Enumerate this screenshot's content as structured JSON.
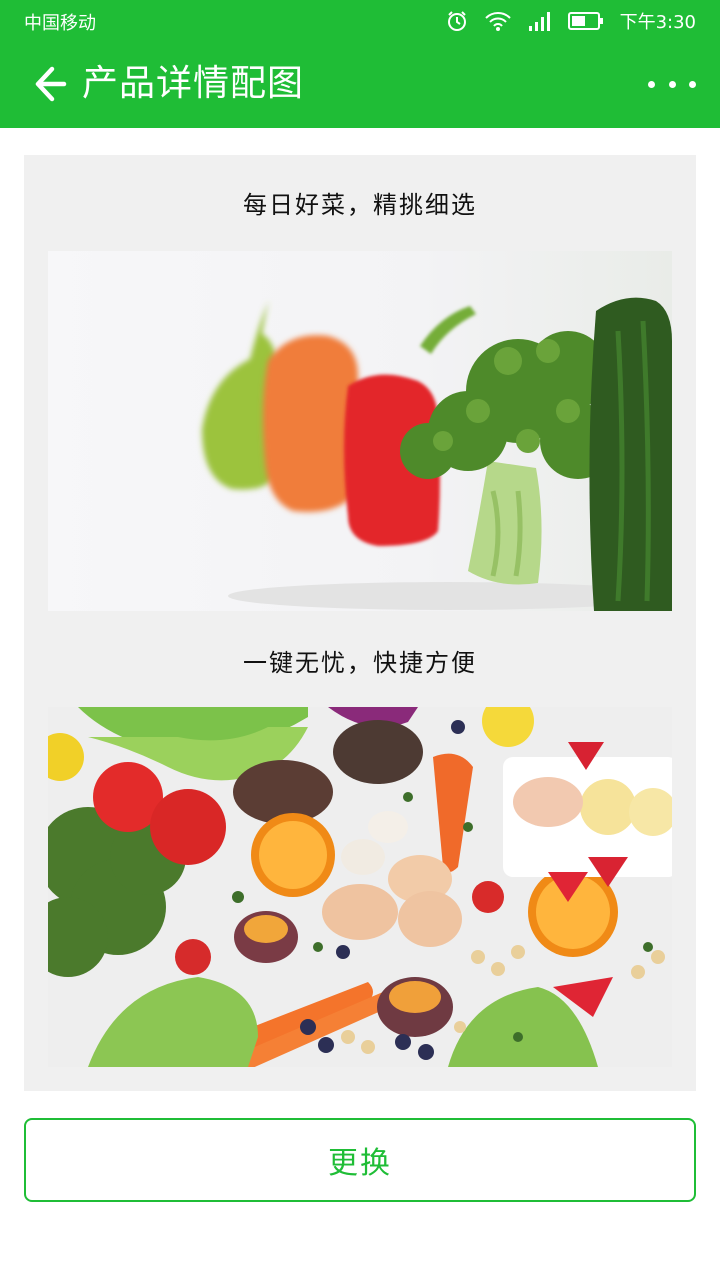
{
  "status_bar": {
    "carrier": "中国移动",
    "time": "下午3:30",
    "icons": [
      "alarm-icon",
      "wifi-icon",
      "signal-icon",
      "battery-icon"
    ]
  },
  "app_bar": {
    "back_icon": "back-arrow-icon",
    "title": "产品详情配图",
    "more_icon": "more-dots-icon"
  },
  "content": {
    "sections": [
      {
        "caption": "每日好菜，精挑细选",
        "image": "vegetables-row-photo"
      },
      {
        "caption": "一键无忧，快捷方便",
        "image": "assorted-produce-photo"
      }
    ]
  },
  "actions": {
    "change_label": "更换"
  },
  "colors": {
    "primary": "#1fbd36",
    "card_bg": "#f0f0f0"
  }
}
